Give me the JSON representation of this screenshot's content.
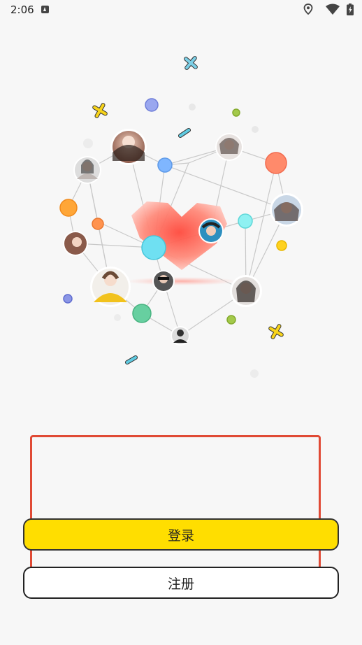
{
  "status_bar": {
    "time": "2:06",
    "icons": [
      "notification-a-icon",
      "location-icon",
      "wifi-icon",
      "battery-charging-icon"
    ]
  },
  "illustration": {
    "heart_color": "#ff5a4e",
    "accent_colors": [
      "#7ecbf2",
      "#ff8a6b",
      "#ffa637",
      "#f8d41b",
      "#67cfa0",
      "#9aa7ef"
    ]
  },
  "actions": {
    "login_label": "登录",
    "register_label": "注册"
  },
  "colors": {
    "login_bg": "#ffde00",
    "highlight_border": "#e04a35"
  }
}
